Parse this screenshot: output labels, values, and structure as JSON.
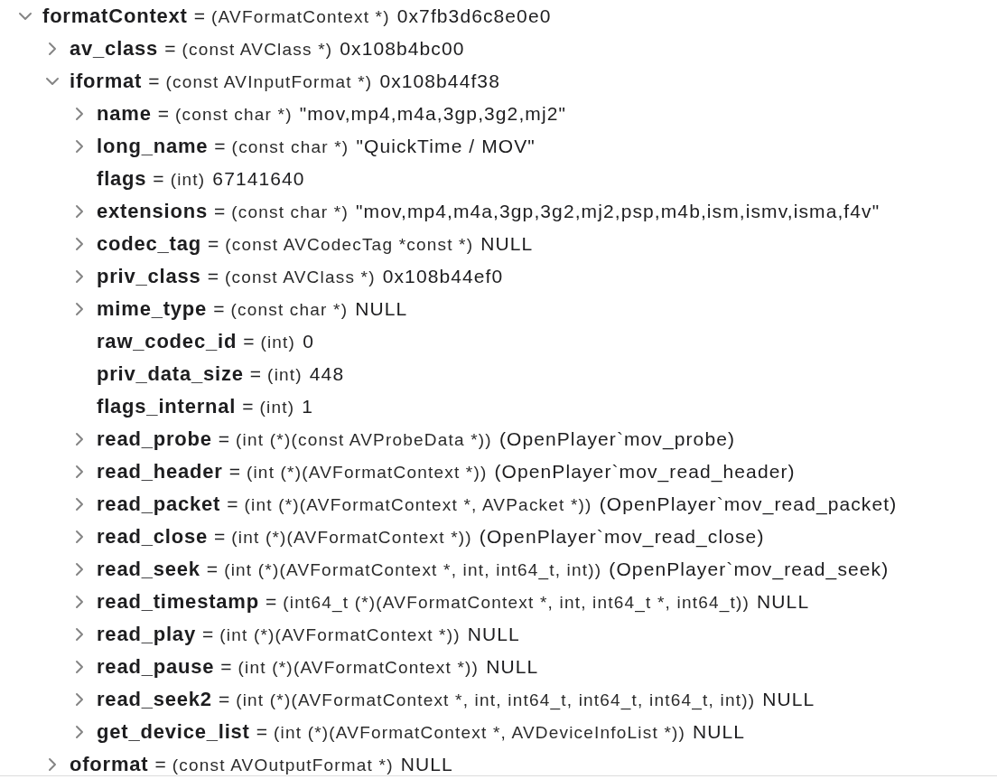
{
  "variables": [
    {
      "kind": "pointer",
      "name": "formatContext",
      "op": "=",
      "type": "(AVFormatContext *)",
      "value": "0x7fb3d6c8e0e0",
      "expanded": true,
      "children": [
        {
          "kind": "pointer",
          "name": "av_class",
          "op": "=",
          "type": "(const AVClass *)",
          "value": "0x108b4bc00",
          "expanded": false
        },
        {
          "kind": "pointer",
          "name": "iformat",
          "op": "=",
          "type": "(const AVInputFormat *)",
          "value": "0x108b44f38",
          "expanded": true,
          "children": [
            {
              "kind": "pointer",
              "name": "name",
              "op": "=",
              "type": "(const char *)",
              "value": "\"mov,mp4,m4a,3gp,3g2,mj2\"",
              "expanded": false
            },
            {
              "kind": "pointer",
              "name": "long_name",
              "op": "=",
              "type": "(const char *)",
              "value": "\"QuickTime / MOV\"",
              "expanded": false
            },
            {
              "kind": "scalar",
              "name": "flags",
              "op": "=",
              "type": "(int)",
              "value": "67141640"
            },
            {
              "kind": "pointer",
              "name": "extensions",
              "op": "=",
              "type": "(const char *)",
              "value": "\"mov,mp4,m4a,3gp,3g2,mj2,psp,m4b,ism,ismv,isma,f4v\"",
              "expanded": false
            },
            {
              "kind": "pointer",
              "name": "codec_tag",
              "op": "=",
              "type": "(const AVCodecTag *const *)",
              "value": "NULL",
              "expanded": false
            },
            {
              "kind": "pointer",
              "name": "priv_class",
              "op": "=",
              "type": "(const AVClass *)",
              "value": "0x108b44ef0",
              "expanded": false
            },
            {
              "kind": "pointer",
              "name": "mime_type",
              "op": "=",
              "type": "(const char *)",
              "value": "NULL",
              "expanded": false
            },
            {
              "kind": "scalar",
              "name": "raw_codec_id",
              "op": "=",
              "type": "(int)",
              "value": "0"
            },
            {
              "kind": "scalar",
              "name": "priv_data_size",
              "op": "=",
              "type": "(int)",
              "value": "448"
            },
            {
              "kind": "scalar",
              "name": "flags_internal",
              "op": "=",
              "type": "(int)",
              "value": "1"
            },
            {
              "kind": "pointer",
              "name": "read_probe",
              "op": "=",
              "type": "(int (*)(const AVProbeData *))",
              "value": "(OpenPlayer`mov_probe)",
              "expanded": false
            },
            {
              "kind": "pointer",
              "name": "read_header",
              "op": "=",
              "type": "(int (*)(AVFormatContext *))",
              "value": "(OpenPlayer`mov_read_header)",
              "expanded": false
            },
            {
              "kind": "pointer",
              "name": "read_packet",
              "op": "=",
              "type": "(int (*)(AVFormatContext *, AVPacket *))",
              "value": "(OpenPlayer`mov_read_packet)",
              "expanded": false
            },
            {
              "kind": "pointer",
              "name": "read_close",
              "op": "=",
              "type": "(int (*)(AVFormatContext *))",
              "value": "(OpenPlayer`mov_read_close)",
              "expanded": false
            },
            {
              "kind": "pointer",
              "name": "read_seek",
              "op": "=",
              "type": "(int (*)(AVFormatContext *, int, int64_t, int))",
              "value": "(OpenPlayer`mov_read_seek)",
              "expanded": false
            },
            {
              "kind": "pointer",
              "name": "read_timestamp",
              "op": "=",
              "type": "(int64_t (*)(AVFormatContext *, int, int64_t *, int64_t))",
              "value": "NULL",
              "expanded": false
            },
            {
              "kind": "pointer",
              "name": "read_play",
              "op": "=",
              "type": "(int (*)(AVFormatContext *))",
              "value": "NULL",
              "expanded": false
            },
            {
              "kind": "pointer",
              "name": "read_pause",
              "op": "=",
              "type": "(int (*)(AVFormatContext *))",
              "value": "NULL",
              "expanded": false
            },
            {
              "kind": "pointer",
              "name": "read_seek2",
              "op": "=",
              "type": "(int (*)(AVFormatContext *, int, int64_t, int64_t, int64_t, int))",
              "value": "NULL",
              "expanded": false
            },
            {
              "kind": "pointer",
              "name": "get_device_list",
              "op": "=",
              "type": "(int (*)(AVFormatContext *, AVDeviceInfoList *))",
              "value": "NULL",
              "expanded": false
            }
          ]
        },
        {
          "kind": "pointer",
          "name": "oformat",
          "op": "=",
          "type": "(const AVOutputFormat *)",
          "value": "NULL",
          "expanded": false
        }
      ]
    }
  ]
}
